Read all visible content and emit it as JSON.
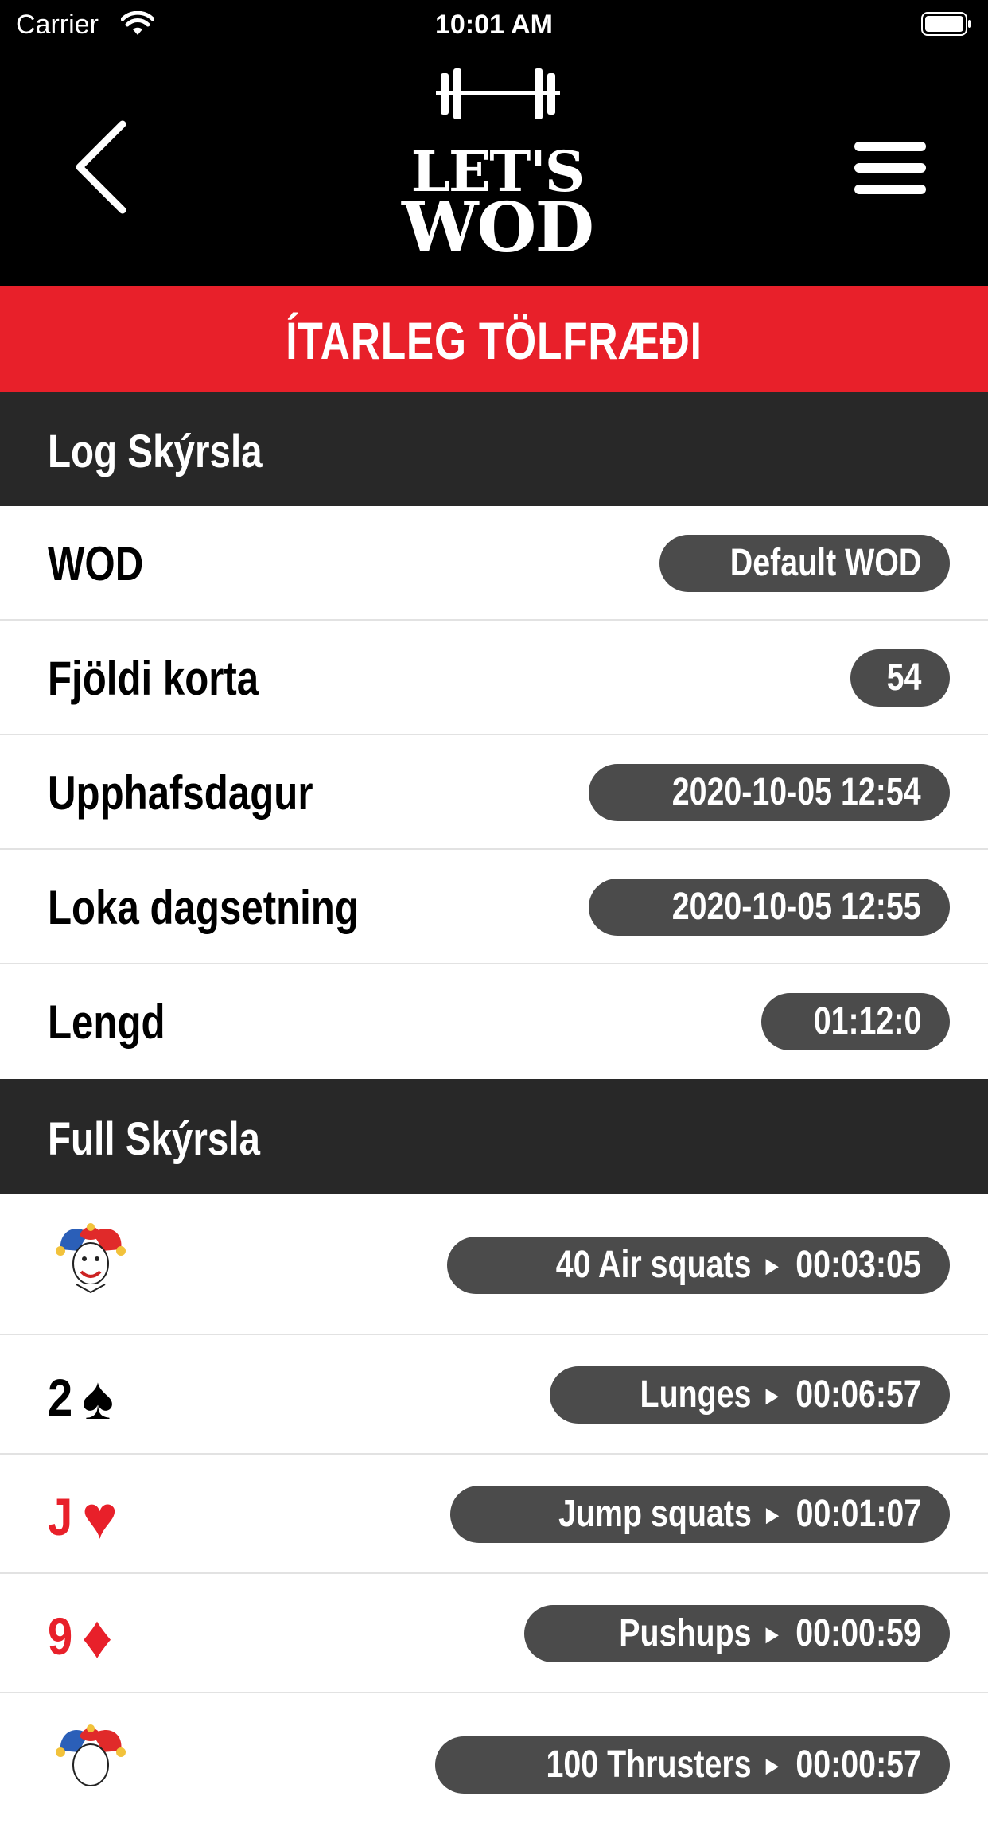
{
  "status_bar": {
    "carrier": "Carrier",
    "time": "10:01 AM"
  },
  "header": {
    "logo_line1": "LET'S",
    "logo_line2": "WOD"
  },
  "title": "ÍTARLEG TÖLFRÆÐI",
  "log_section": {
    "heading": "Log Skýrsla",
    "rows": [
      {
        "label": "WOD",
        "value": "Default WOD"
      },
      {
        "label": "Fjöldi korta",
        "value": "54"
      },
      {
        "label": "Upphafsdagur",
        "value": "2020-10-05 12:54"
      },
      {
        "label": "Loka dagsetning",
        "value": "2020-10-05 12:55"
      },
      {
        "label": "Lengd",
        "value": "01:12:0"
      }
    ]
  },
  "full_section": {
    "heading": "Full Skýrsla",
    "cards": [
      {
        "card": "joker",
        "rank": "",
        "suit": "",
        "exercise": "40 Air squats",
        "time": "00:03:05"
      },
      {
        "card": "2-spades",
        "rank": "2",
        "suit": "♠",
        "color": "#000000",
        "exercise": "Lunges",
        "time": "00:06:57"
      },
      {
        "card": "J-hearts",
        "rank": "J",
        "suit": "♥",
        "color": "#e8202a",
        "exercise": "Jump squats",
        "time": "00:01:07"
      },
      {
        "card": "9-diamonds",
        "rank": "9",
        "suit": "♦",
        "color": "#e8202a",
        "exercise": "Pushups",
        "time": "00:00:59"
      },
      {
        "card": "joker",
        "rank": "",
        "suit": "",
        "exercise": "100 Thrusters",
        "time": "00:00:57"
      }
    ]
  },
  "colors": {
    "accent": "#e8202a",
    "section_bg": "#282828",
    "pill_bg": "#4b4b4b"
  },
  "icons": [
    "back-chevron-icon",
    "hamburger-menu-icon",
    "barbell-icon",
    "wifi-icon",
    "battery-icon",
    "joker-icon",
    "spade-icon",
    "heart-icon",
    "diamond-icon"
  ]
}
